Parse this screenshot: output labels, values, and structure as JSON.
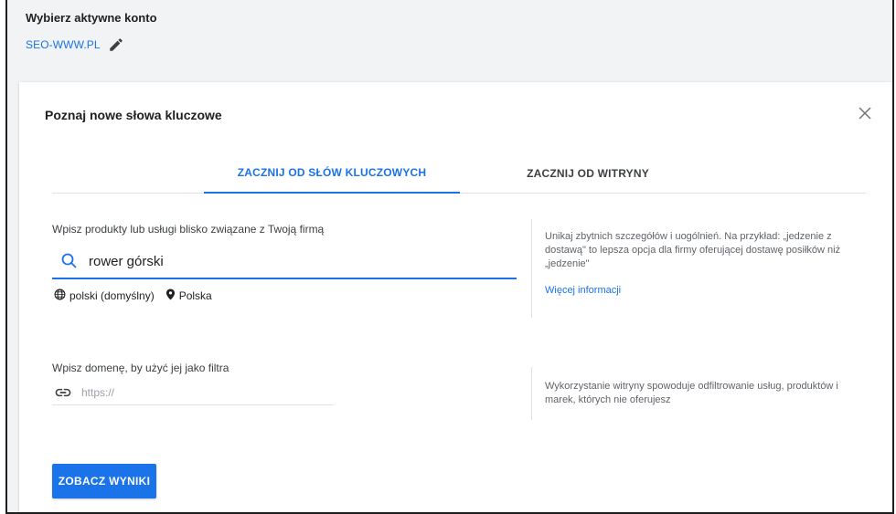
{
  "account": {
    "title": "Wybierz aktywne konto",
    "name": "SEO-WWW.PL",
    "edit_icon": "pencil-icon"
  },
  "dialog": {
    "title": "Poznaj nowe słowa kluczowe",
    "close_icon": "close-icon",
    "tabs": [
      {
        "label": "ZACZNIJ OD SŁÓW KLUCZOWYCH",
        "active": true
      },
      {
        "label": "ZACZNIJ OD WITRYNY",
        "active": false
      }
    ],
    "keywords": {
      "label": "Wpisz produkty lub usługi blisko związane z Twoją firmą",
      "value": "rower górski",
      "icon": "search-icon",
      "language": "polski (domyślny)",
      "language_icon": "globe-icon",
      "location": "Polska",
      "location_icon": "location-pin-icon",
      "hint": "Unikaj zbytnich szczegółów i uogólnień. Na przykład: „jedzenie z dostawą\" to lepsza opcja dla firmy oferującej dostawę posiłków niż „jedzenie\"",
      "more_link": "Więcej informacji"
    },
    "domain": {
      "label": "Wpisz domenę, by użyć jej jako filtra",
      "placeholder": "https://",
      "icon": "link-icon",
      "hint": "Wykorzystanie witryny spowoduje odfiltrowanie usług, produktów i marek, których nie oferujesz"
    },
    "submit_label": "ZOBACZ WYNIKI"
  },
  "colors": {
    "accent": "#1a73e8",
    "background": "#f1f3f4"
  }
}
